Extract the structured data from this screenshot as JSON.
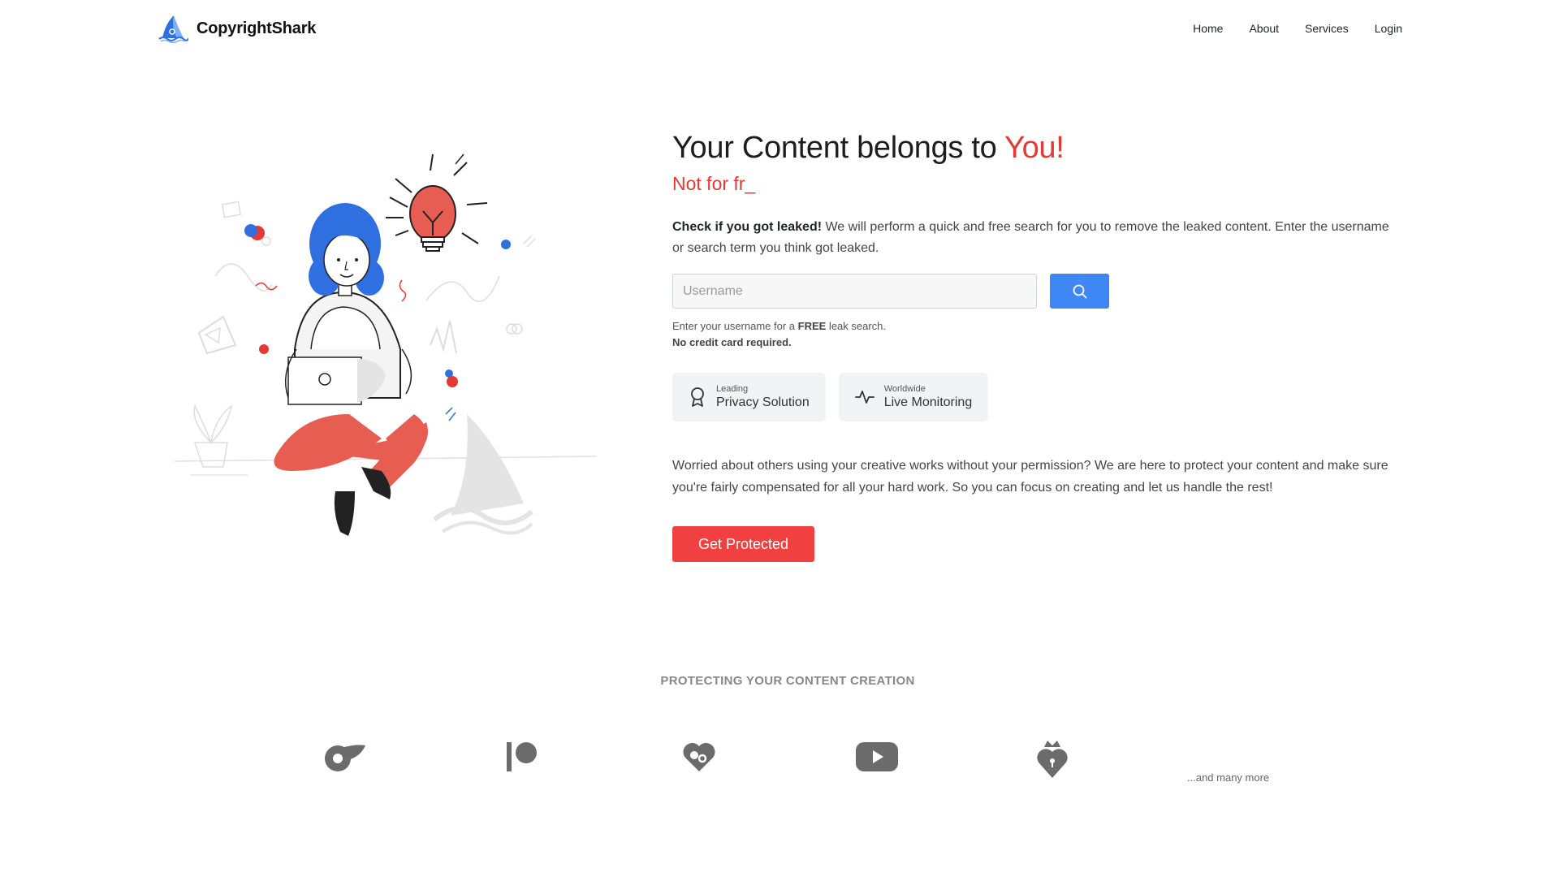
{
  "header": {
    "brand": "CopyrightShark",
    "nav": [
      "Home",
      "About",
      "Services",
      "Login"
    ]
  },
  "hero": {
    "title_main": "Your Content belongs to ",
    "title_accent": "You!",
    "subtitle": "Not for fr_",
    "desc_bold": "Check if you got leaked!",
    "desc_rest": " We will perform a quick and free search for you to remove the leaked content. Enter the username or search term you think got leaked.",
    "search": {
      "placeholder": "Username",
      "value": ""
    },
    "hint_pre": "Enter your username for a ",
    "hint_bold": "FREE",
    "hint_post": " leak search.",
    "hint_line2": "No credit card required.",
    "badges": [
      {
        "small": "Leading",
        "big": "Privacy Solution",
        "icon": "award-icon"
      },
      {
        "small": "Worldwide",
        "big": "Live Monitoring",
        "icon": "activity-icon"
      }
    ],
    "paragraph": "Worried about others using your creative works without your permission? We are here to protect your content and make sure you're fairly compensated for all your hard work. So you can focus on creating and let us handle the rest!",
    "cta": "Get Protected"
  },
  "partners": {
    "title": "PROTECTING YOUR CONTENT CREATION",
    "logos": [
      "onlyfans-icon",
      "patreon-icon",
      "fansly-icon",
      "youtube-icon",
      "royal-heart-icon"
    ],
    "more": "...and many more"
  },
  "colors": {
    "accent": "#e53935",
    "primary": "#3f87f5",
    "cta": "#f04040",
    "illustration_blue": "#2f6fe0"
  }
}
